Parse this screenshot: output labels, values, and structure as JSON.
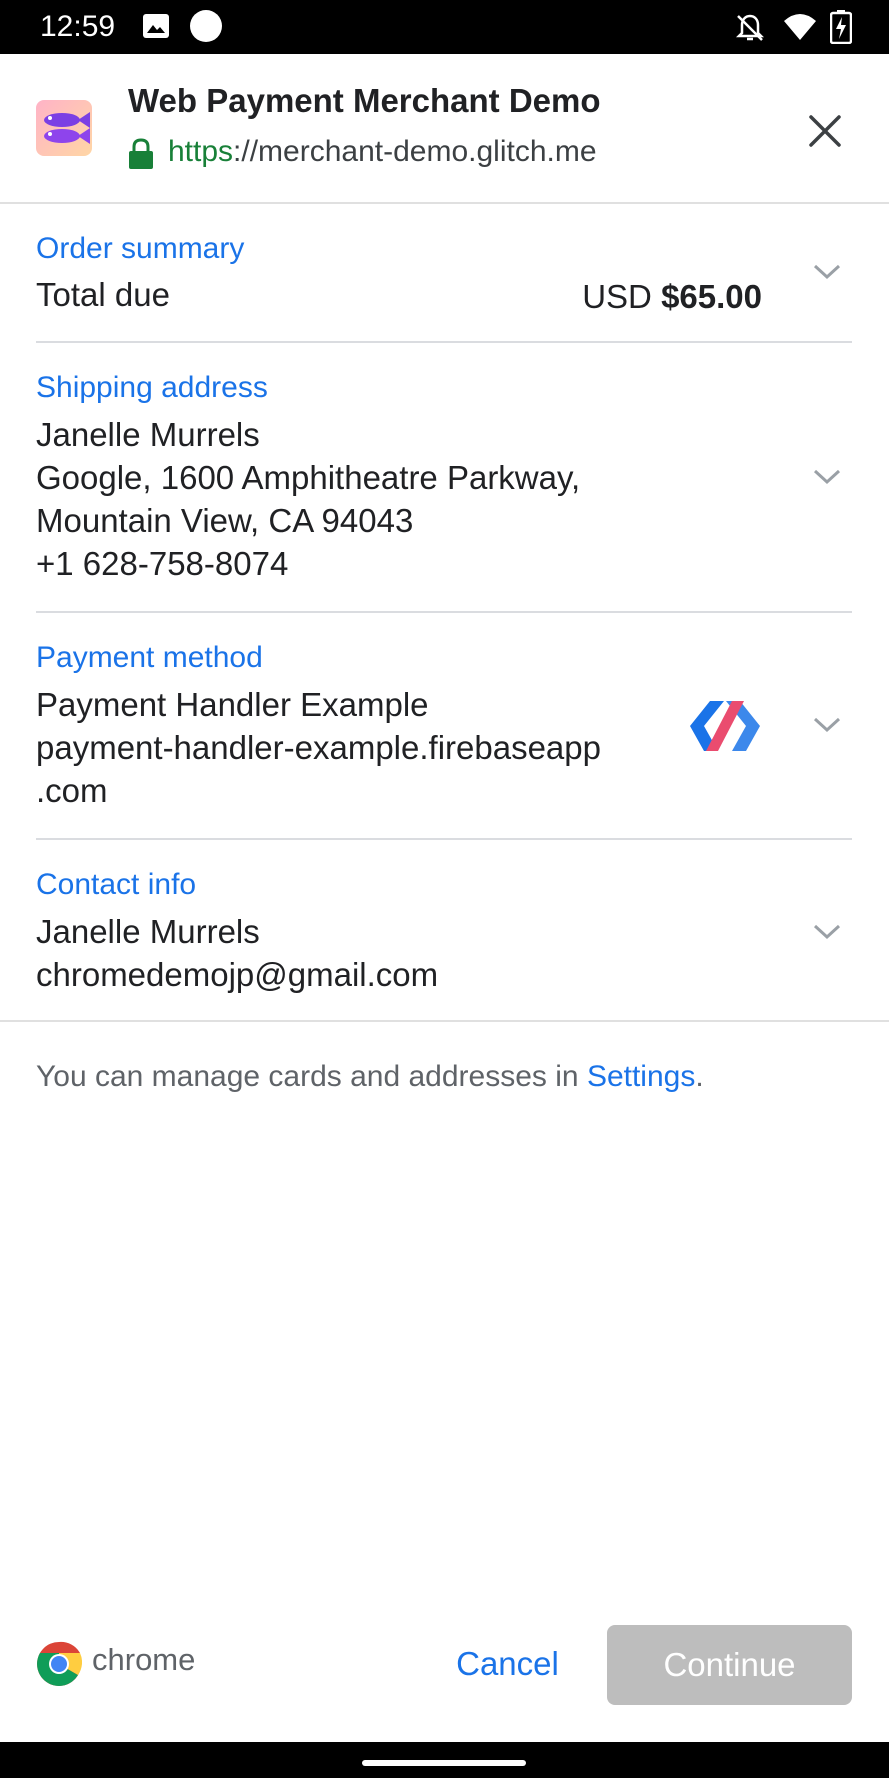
{
  "status_bar": {
    "time": "12:59",
    "icons": [
      "gallery-icon",
      "circle-icon",
      "notifications-off-icon",
      "wifi-icon",
      "battery-charging-icon"
    ]
  },
  "header": {
    "title": "Web Payment Merchant Demo",
    "url_scheme": "https",
    "url_rest": "://merchant-demo.glitch.me",
    "close_icon": "close-icon"
  },
  "order_summary": {
    "label": "Order summary",
    "total_label": "Total due",
    "currency": "USD",
    "amount": "$65.00"
  },
  "shipping": {
    "label": "Shipping address",
    "lines": [
      "Janelle Murrels",
      "Google, 1600 Amphitheatre Parkway,",
      "Mountain View, CA 94043",
      "+1 628-758-8074"
    ]
  },
  "payment": {
    "label": "Payment method",
    "lines": [
      "Payment Handler Example",
      "payment-handler-example.firebaseapp",
      ".com"
    ],
    "icon": "payment-handler-logo-icon"
  },
  "contact": {
    "label": "Contact info",
    "lines": [
      "Janelle Murrels",
      "chromedemojp@gmail.com"
    ]
  },
  "settings_note": {
    "prefix": "You can manage cards and addresses in ",
    "link": "Settings",
    "suffix": "."
  },
  "footer": {
    "brand": "chrome",
    "cancel": "Cancel",
    "continue": "Continue"
  },
  "colors": {
    "accent": "#1a73e8",
    "secure_green": "#188038",
    "disabled_button": "#bdbdbd"
  }
}
